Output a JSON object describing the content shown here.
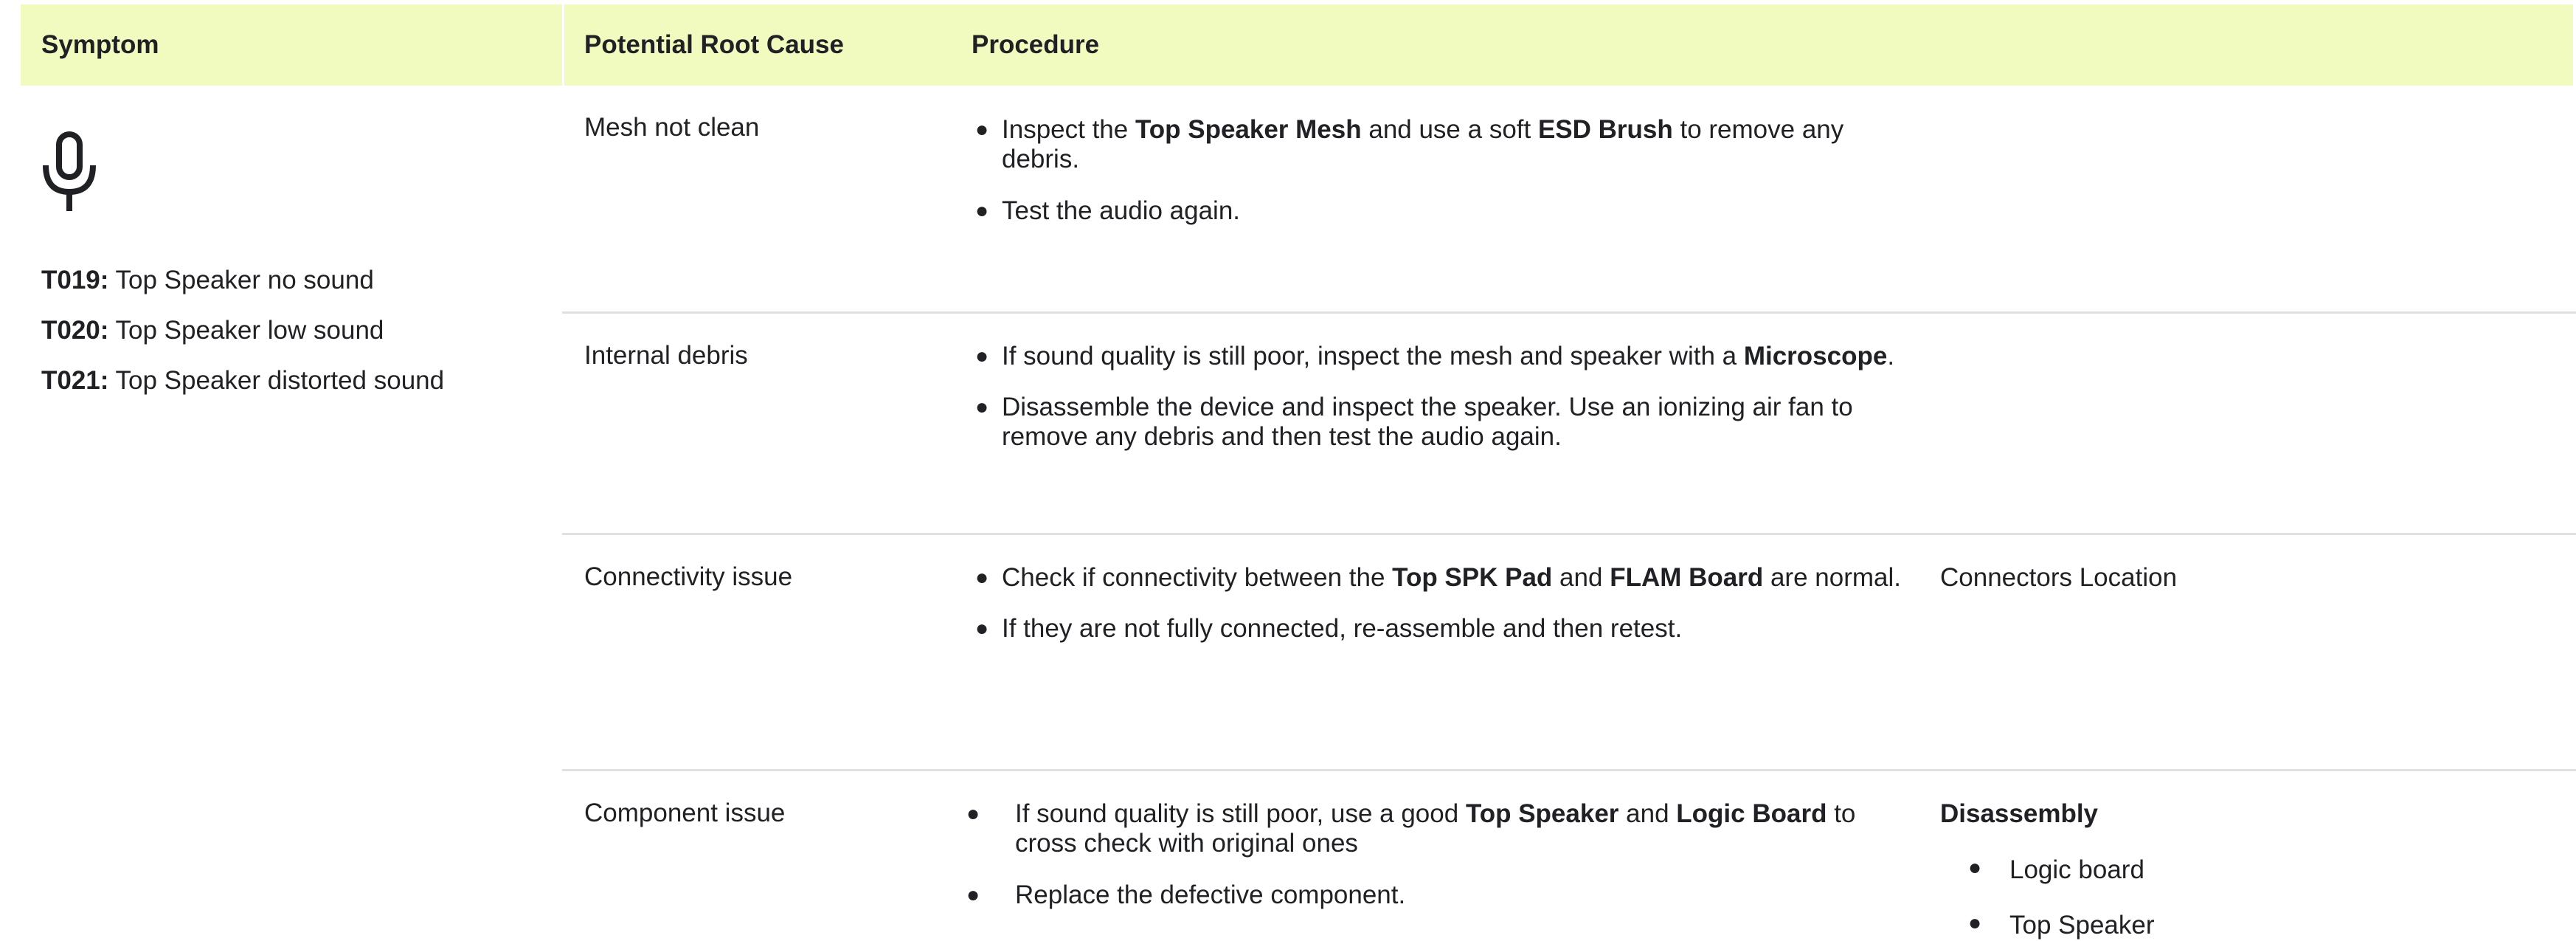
{
  "header": {
    "symptom": "Symptom",
    "root_cause": "Potential Root Cause",
    "procedure": "Procedure"
  },
  "symptom": {
    "icon": "microphone-icon",
    "codes": [
      {
        "code": "T019:",
        "text": " Top Speaker no sound"
      },
      {
        "code": "T020:",
        "text": " Top Speaker low sound"
      },
      {
        "code": "T021:",
        "text": " Top Speaker distorted sound"
      }
    ]
  },
  "rows": [
    {
      "cause": "Mesh not clean",
      "procedure": [
        {
          "line1": [
            {
              "t": "Inspect the "
            },
            {
              "t": "Top Speaker Mesh",
              "b": true
            },
            {
              "t": " and use a soft "
            },
            {
              "t": "ESD Brush",
              "b": true
            },
            {
              "t": " to remove any"
            }
          ],
          "line2": "debris."
        },
        {
          "line1": [
            {
              "t": "Test the audio again."
            }
          ]
        }
      ]
    },
    {
      "cause": "Internal debris",
      "procedure": [
        {
          "line1": [
            {
              "t": "If sound quality is still poor, inspect the mesh and speaker with a "
            },
            {
              "t": "Microscope",
              "b": true
            },
            {
              "t": "."
            }
          ]
        },
        {
          "line1": [
            {
              "t": "Disassemble the device and inspect the speaker. Use an ionizing air fan to"
            }
          ],
          "line2": "remove any debris and then test the audio again."
        }
      ]
    },
    {
      "cause": "Connectivity issue",
      "procedure": [
        {
          "line1": [
            {
              "t": "Check if connectivity between the "
            },
            {
              "t": "Top SPK Pad",
              "b": true
            },
            {
              "t": " and "
            },
            {
              "t": "FLAM Board",
              "b": true
            },
            {
              "t": " are normal."
            }
          ]
        },
        {
          "line1": [
            {
              "t": "If they are not fully connected, re-assemble and then retest."
            }
          ]
        }
      ],
      "extra_title": "Connectors Location"
    },
    {
      "cause": "Component issue",
      "procedure": [
        {
          "line1": [
            {
              "t": "If sound quality is still poor, use a good "
            },
            {
              "t": "Top Speaker",
              "b": true
            },
            {
              "t": " and "
            },
            {
              "t": "Logic Board",
              "b": true
            },
            {
              "t": " to"
            }
          ],
          "line2": "cross check with original ones"
        },
        {
          "line1": [
            {
              "t": "Replace the defective component."
            }
          ]
        }
      ],
      "extra_title": "Disassembly",
      "extra_items": [
        "Logic board",
        "Top Speaker"
      ]
    }
  ]
}
